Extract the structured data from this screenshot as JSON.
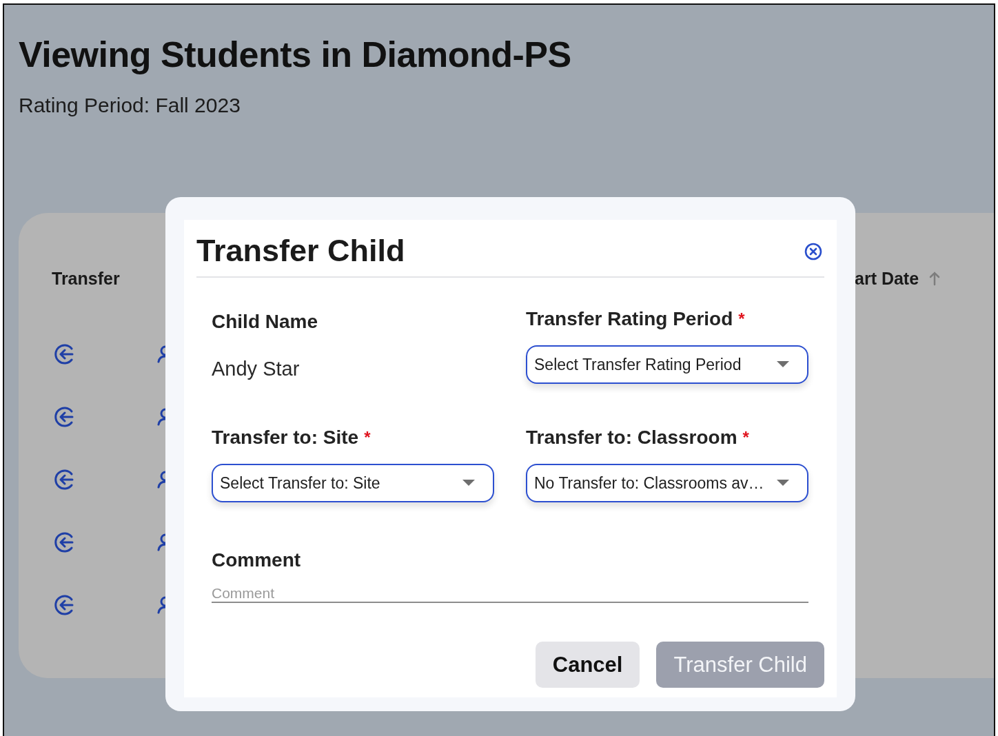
{
  "page": {
    "title": "Viewing Students in Diamond-PS",
    "subtitle": "Rating Period: Fall 2023"
  },
  "table": {
    "columns": [
      {
        "label": "Transfer",
        "sort_ascending": false
      },
      {
        "label": "art Date",
        "sort_ascending": true
      }
    ],
    "rows": [
      {
        "kind": "icons"
      },
      {
        "kind": "icons"
      },
      {
        "kind": "icons"
      },
      {
        "kind": "icons"
      },
      {
        "kind": "icons"
      }
    ]
  },
  "dialog": {
    "title": "Transfer Child",
    "fields": [
      {
        "kind": "static",
        "label": "Child Name",
        "value": "Andy Star"
      },
      {
        "kind": "select",
        "label": "Transfer Rating Period",
        "value": "Select Transfer Rating Period",
        "required_mark": "*"
      },
      {
        "kind": "select",
        "label": "Transfer to: Site",
        "value": "Select Transfer to: Site",
        "required_mark": "*"
      },
      {
        "kind": "select",
        "label": "Transfer to: Classroom",
        "value": "No Transfer to: Classrooms av…",
        "required_mark": "*"
      }
    ],
    "comment": {
      "label": "Comment",
      "placeholder": "Comment"
    },
    "buttons": [
      {
        "label": "Cancel",
        "kind": "secondary",
        "disabled": false
      },
      {
        "label": "Transfer Child",
        "kind": "primary",
        "disabled": true
      }
    ]
  }
}
